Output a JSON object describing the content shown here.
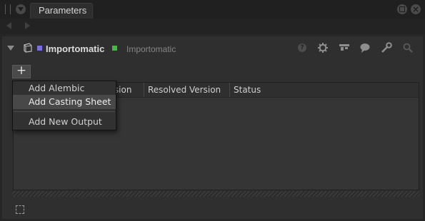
{
  "window": {
    "tab_title": "Parameters"
  },
  "node": {
    "name": "Importomatic",
    "class_name": "Importomatic",
    "colors": {
      "left": "#7a6ee0",
      "right": "#45b845"
    }
  },
  "header_icons": [
    "help-icon",
    "gear-icon",
    "layout-icon",
    "comment-icon",
    "wrench-icon",
    "search-icon"
  ],
  "toolbar": {
    "add_button_label": "+"
  },
  "table": {
    "columns": [
      "rsion",
      "Resolved Version",
      "Status"
    ]
  },
  "menu": {
    "items": [
      "Add Alembic",
      "Add Casting Sheet",
      "Add New Output"
    ],
    "highlighted": "Add Casting Sheet"
  }
}
